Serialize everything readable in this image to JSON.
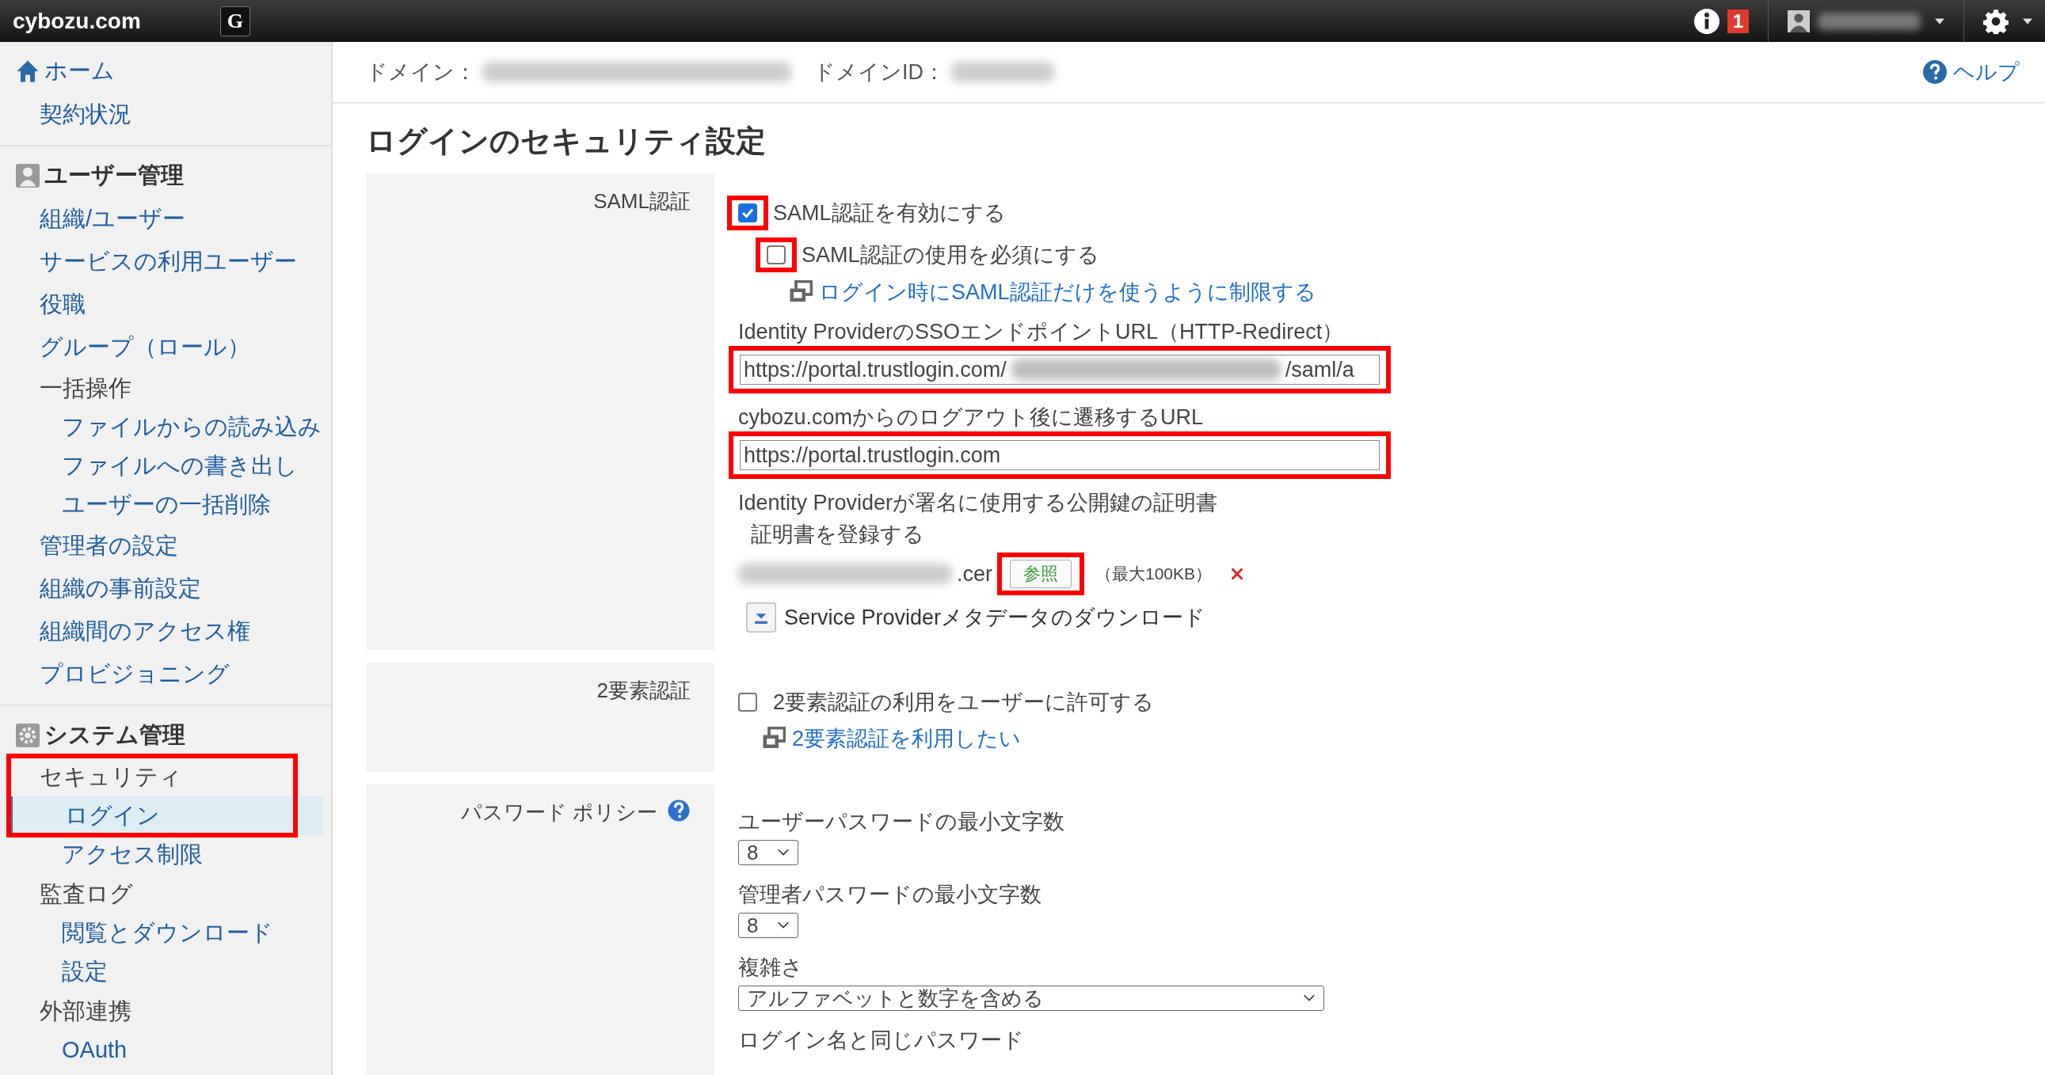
{
  "topbar": {
    "logo": "cybozu.com",
    "app_button": "G",
    "notification_count": "1"
  },
  "sidebar": {
    "sections": [
      {
        "heading": {
          "label": "ホーム",
          "kind": "link"
        },
        "items": [
          {
            "label": "契約状況",
            "kind": "link",
            "selected": false,
            "highlighted": false
          }
        ]
      },
      {
        "heading": {
          "label": "ユーザー管理",
          "kind": "title"
        },
        "items": [
          {
            "label": "組織/ユーザー",
            "kind": "link",
            "selected": false,
            "highlighted": false
          },
          {
            "label": "サービスの利用ユーザー",
            "kind": "link",
            "selected": false,
            "highlighted": false
          },
          {
            "label": "役職",
            "kind": "link",
            "selected": false,
            "highlighted": false
          },
          {
            "label": "グループ（ロール）",
            "kind": "link",
            "selected": false,
            "highlighted": false
          },
          {
            "label": "一括操作",
            "kind": "group",
            "selected": false,
            "highlighted": false,
            "children": [
              {
                "label": "ファイルからの読み込み",
                "selected": false
              },
              {
                "label": "ファイルへの書き出し",
                "selected": false
              },
              {
                "label": "ユーザーの一括削除",
                "selected": false
              }
            ]
          },
          {
            "label": "管理者の設定",
            "kind": "link",
            "selected": false,
            "highlighted": false
          },
          {
            "label": "組織の事前設定",
            "kind": "link",
            "selected": false,
            "highlighted": false
          },
          {
            "label": "組織間のアクセス権",
            "kind": "link",
            "selected": false,
            "highlighted": false
          },
          {
            "label": "プロビジョニング",
            "kind": "link",
            "selected": false,
            "highlighted": false
          }
        ]
      },
      {
        "heading": {
          "label": "システム管理",
          "kind": "title"
        },
        "items": [
          {
            "label": "セキュリティ",
            "kind": "group",
            "selected": false,
            "highlighted": true,
            "children": [
              {
                "label": "ログイン",
                "selected": true
              },
              {
                "label": "アクセス制限",
                "selected": false
              }
            ]
          },
          {
            "label": "監査ログ",
            "kind": "group",
            "selected": false,
            "highlighted": false,
            "children": [
              {
                "label": "閲覧とダウンロード",
                "selected": false
              },
              {
                "label": "設定",
                "selected": false
              }
            ]
          },
          {
            "label": "外部連携",
            "kind": "group",
            "selected": false,
            "highlighted": false,
            "children": [
              {
                "label": "OAuth",
                "selected": false
              }
            ]
          }
        ]
      }
    ]
  },
  "header": {
    "domain_label": "ドメイン：",
    "domain_id_label": "ドメインID：",
    "help": "ヘルプ"
  },
  "title": "ログインのセキュリティ設定",
  "sections": [
    {
      "label": "SAML認証",
      "help": false,
      "fields": [
        {
          "kind": "checkbox",
          "label": "SAML認証を有効にする",
          "checked": true,
          "indented": false,
          "highlighted": true
        },
        {
          "kind": "checkbox",
          "label": "SAML認証の使用を必須にする",
          "checked": false,
          "indented": true,
          "highlighted": true
        },
        {
          "kind": "link",
          "label": "ログイン時にSAML認証だけを使うように制限する",
          "indented": true
        },
        {
          "kind": "text_input",
          "label": "Identity ProviderのSSOエンドポイントURL（HTTP-Redirect）",
          "value": "https://portal.trustlogin.com/",
          "value_end": "/saml/a",
          "highlighted": true
        },
        {
          "kind": "text_input",
          "label": "cybozu.comからのログアウト後に遷移するURL",
          "value": "https://portal.trustlogin.com",
          "highlighted": true
        },
        {
          "kind": "file",
          "label": "Identity Providerが署名に使用する公開鍵の証明書",
          "sublabel": "証明書を登録する",
          "file_name": ".cer",
          "button": "参照",
          "limit": "（最大100KB）",
          "highlighted": true
        },
        {
          "kind": "download",
          "label": "Service Providerメタデータのダウンロード"
        }
      ]
    },
    {
      "label": "2要素認証",
      "help": false,
      "fields": [
        {
          "kind": "checkbox",
          "label": "2要素認証の利用をユーザーに許可する",
          "checked": false,
          "indented": false,
          "highlighted": false
        },
        {
          "kind": "link",
          "label": "2要素認証を利用したい",
          "indented": false
        }
      ]
    },
    {
      "label": "パスワード ポリシー",
      "help": true,
      "fields": [
        {
          "kind": "select",
          "label": "ユーザーパスワードの最小文字数",
          "value": "8",
          "wide": false
        },
        {
          "kind": "select",
          "label": "管理者パスワードの最小文字数",
          "value": "8",
          "wide": false
        },
        {
          "kind": "select",
          "label": "複雑さ",
          "value": "アルファベットと数字を含める",
          "wide": true
        },
        {
          "kind": "text",
          "label": "ログイン名と同じパスワード"
        }
      ]
    }
  ]
}
